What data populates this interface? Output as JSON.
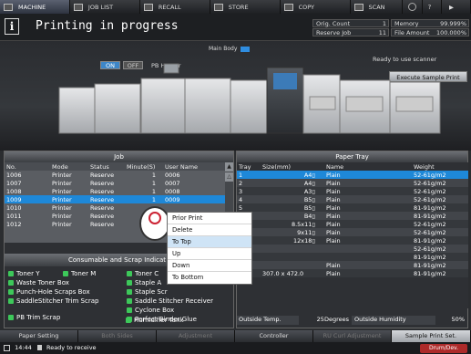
{
  "topnav": {
    "tabs": [
      {
        "label": "MACHINE",
        "icon": "machine-icon"
      },
      {
        "label": "JOB LIST",
        "icon": "joblist-icon"
      },
      {
        "label": "RECALL",
        "icon": "recall-icon"
      },
      {
        "label": "STORE",
        "icon": "store-icon"
      },
      {
        "label": "COPY",
        "icon": "copy-icon"
      },
      {
        "label": "SCAN",
        "icon": "scan-icon"
      }
    ]
  },
  "header": {
    "title": "Printing in progress",
    "orig_count_label": "Orig. Count",
    "orig_count_value": "1",
    "memory_label": "Memory",
    "memory_value": "99.999%",
    "reserve_job_label": "Reserve Job",
    "reserve_job_value": "11",
    "file_amount_label": "File Amount",
    "file_amount_value": "100.000%"
  },
  "machine": {
    "main_body_label": "Main Body",
    "on_label": "ON",
    "off_label": "OFF",
    "pb_heater_label": "PB Heater",
    "ready_scanner": "Ready to use scanner",
    "sample_print_button": "Execute Sample Print"
  },
  "job": {
    "title": "Job",
    "columns": [
      "No.",
      "Mode",
      "Status",
      "Minute(S)",
      "User Name"
    ],
    "rows": [
      [
        "1006",
        "Printer",
        "Reserve",
        "1",
        "0006"
      ],
      [
        "1007",
        "Printer",
        "Reserve",
        "1",
        "0007"
      ],
      [
        "1008",
        "Printer",
        "Reserve",
        "1",
        "0008"
      ],
      [
        "1009",
        "Printer",
        "Reserve",
        "1",
        "0009"
      ],
      [
        "1010",
        "Printer",
        "Reserve",
        "",
        ""
      ],
      [
        "1011",
        "Printer",
        "Reserve",
        "",
        ""
      ],
      [
        "1012",
        "Printer",
        "Reserve",
        "",
        ""
      ]
    ],
    "selected_index": 3
  },
  "context_menu": {
    "items": [
      "Prior Print",
      "Delete",
      "To Top",
      "Up",
      "Down",
      "To Bottom"
    ],
    "highlighted": "To Top"
  },
  "consumables": {
    "title": "Consumable and Scrap Indicat",
    "items": [
      "Toner Y",
      "Toner M",
      "Toner C",
      "Waste Toner Box",
      "Staple A",
      "Punch-Hole Scraps Box",
      "Staple Scr",
      "SaddleStitcher Trim Scrap",
      "Saddle Stitcher Receiver",
      "Cyclone Box",
      "PB Trim Scrap",
      "Perfect Binder Glue",
      "Humidifier Tank"
    ]
  },
  "paper_tray": {
    "title": "Paper Tray",
    "columns": [
      "Tray",
      "Size(mm)",
      "Name",
      "Weight"
    ],
    "rows": [
      [
        "1",
        "A4▯",
        "Plain",
        "52-61g/m2"
      ],
      [
        "2",
        "A4▯",
        "Plain",
        "52-61g/m2"
      ],
      [
        "3",
        "A3▯",
        "Plain",
        "52-61g/m2"
      ],
      [
        "4",
        "B5▯",
        "Plain",
        "52-61g/m2"
      ],
      [
        "5",
        "B5▯",
        "Plain",
        "81-91g/m2"
      ],
      [
        "6",
        "B4▯",
        "Plain",
        "81-91g/m2"
      ],
      [
        "7",
        "8.5x11▯",
        "Plain",
        "52-61g/m2"
      ],
      [
        "8",
        "9x11▯",
        "Plain",
        "52-61g/m2"
      ],
      [
        "9",
        "12x18▯",
        "Plain",
        "81-91g/m2"
      ],
      [
        "",
        "",
        "",
        "52-61g/m2"
      ],
      [
        "",
        "",
        "",
        "81-91g/m2"
      ],
      [
        "",
        "",
        "Plain",
        "81-91g/m2"
      ],
      [
        "PB",
        "307.0 x 472.0",
        "Plain",
        "81-91g/m2"
      ]
    ],
    "outside_temp_label": "Outside Temp.",
    "outside_temp_value": "25Degrees",
    "outside_humidity_label": "Outside Humidity",
    "outside_humidity_value": "50%"
  },
  "bottom_tabs": [
    "Paper Setting",
    "Both Sides",
    "Adjustment",
    "Controller",
    "RU Curl Adjustment",
    "Sample Print Set."
  ],
  "status": {
    "time": "14:44",
    "message": "Ready to receive",
    "drum_button": "Drum/Dev."
  }
}
